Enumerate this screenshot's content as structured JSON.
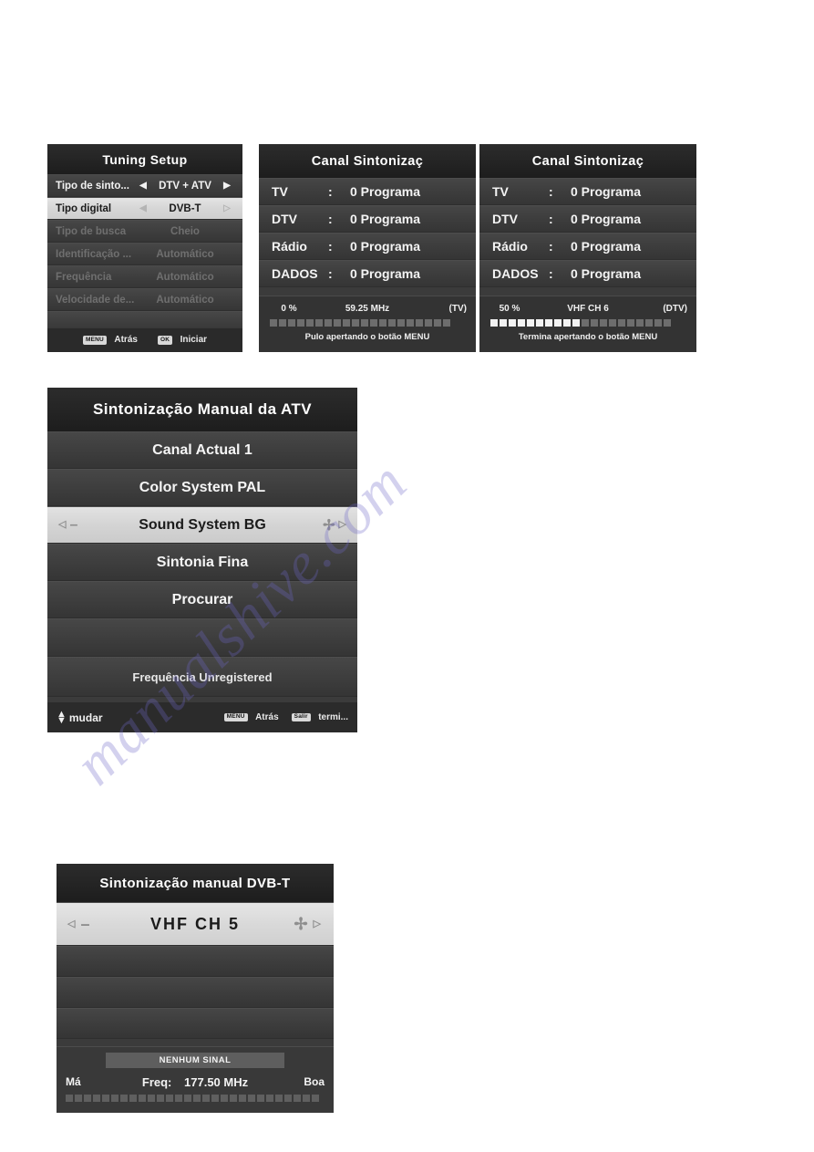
{
  "tuning_setup": {
    "title": "Tuning Setup",
    "rows": [
      {
        "label": "Tipo de sinto...",
        "value": "DTV + ATV",
        "state": "normal"
      },
      {
        "label": "Tipo digital",
        "value": "DVB-T",
        "state": "selected"
      },
      {
        "label": "Tipo de busca",
        "value": "Cheio",
        "state": "disabled"
      },
      {
        "label": "Identificação ...",
        "value": "Automático",
        "state": "disabled"
      },
      {
        "label": "Frequência",
        "value": "Automático",
        "state": "disabled"
      },
      {
        "label": "Velocidade de...",
        "value": "Automático",
        "state": "disabled"
      }
    ],
    "footer": {
      "back_key": "MENU",
      "back_label": "Atrás",
      "start_key": "OK",
      "start_label": "Iniciar"
    }
  },
  "scan_atv": {
    "title": "Canal Sintonizaç",
    "rows": [
      {
        "name": "TV",
        "colon": ":",
        "value": "0 Programa"
      },
      {
        "name": "DTV",
        "colon": ":",
        "value": "0 Programa"
      },
      {
        "name": "Rádio",
        "colon": ":",
        "value": "0 Programa"
      },
      {
        "name": "DADOS",
        "colon": ":",
        "value": "0 Programa"
      }
    ],
    "status": {
      "percent_label": "0  %",
      "percent_value": 0,
      "middle": "59.25 MHz",
      "type": "(TV)",
      "blocks_total": 20,
      "blocks_on": 0
    },
    "hint": "Pulo apertando o botão MENU"
  },
  "scan_dtv": {
    "title": "Canal Sintonizaç",
    "rows": [
      {
        "name": "TV",
        "colon": ":",
        "value": "0 Programa"
      },
      {
        "name": "DTV",
        "colon": ":",
        "value": "0 Programa"
      },
      {
        "name": "Rádio",
        "colon": ":",
        "value": "0 Programa"
      },
      {
        "name": "DADOS",
        "colon": ":",
        "value": "0 Programa"
      }
    ],
    "status": {
      "percent_label": "50 %",
      "percent_value": 50,
      "middle": "VHF  CH  6",
      "type": "(DTV)",
      "blocks_total": 20,
      "blocks_on": 10
    },
    "hint": "Termina apertando o botão MENU"
  },
  "atv_manual": {
    "title": "Sintonização Manual da ATV",
    "rows": [
      {
        "label": "Canal Actual 1",
        "state": "normal",
        "kind": "item"
      },
      {
        "label": "Color System PAL",
        "state": "normal",
        "kind": "item"
      },
      {
        "label": "Sound System BG",
        "state": "selected",
        "kind": "item"
      },
      {
        "label": "Sintonia Fina",
        "state": "normal",
        "kind": "item"
      },
      {
        "label": "Procurar",
        "state": "normal",
        "kind": "item"
      },
      {
        "label": "",
        "state": "normal",
        "kind": "blank"
      },
      {
        "label": "Frequência Unregistered",
        "state": "normal",
        "kind": "freq"
      }
    ],
    "footer": {
      "change_label": "mudar",
      "back_key": "MENU",
      "back_label": "Atrás",
      "exit_key": "Salir",
      "exit_label": "termi..."
    }
  },
  "dvbt_manual": {
    "title": "Sintonização manual DVB-T",
    "rows": [
      {
        "label": "VHF  CH  5",
        "state": "selected"
      },
      {
        "label": "",
        "state": "blank"
      },
      {
        "label": "",
        "state": "blank"
      },
      {
        "label": "",
        "state": "blank"
      }
    ],
    "signal": {
      "status": "NENHUM SINAL",
      "bad_label": "Má",
      "freq_label": "Freq:",
      "freq_value": "177.50 MHz",
      "good_label": "Boa",
      "blocks_total": 28,
      "blocks_on": 0
    }
  },
  "watermark": {
    "text": "manualshive.com"
  },
  "colors": {
    "panel_bg": "#3b3b3b",
    "title_bg": "#242424",
    "row_bg": "#3e3e3e",
    "selected_bg": "#d6d6d6",
    "text": "#f2f2f2",
    "disabled_text": "#6f6f6f",
    "block_off": "#6d6d6d",
    "block_on": "#f2f2f2",
    "watermark": "#6c68c8"
  }
}
